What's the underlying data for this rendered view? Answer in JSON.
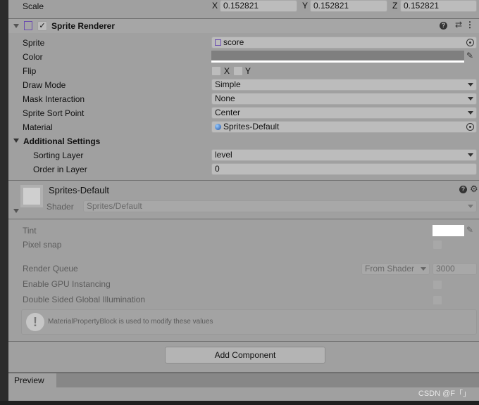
{
  "transform": {
    "scale_label": "Scale",
    "x_label": "X",
    "y_label": "Y",
    "z_label": "Z",
    "x": "0.152821",
    "y": "0.152821",
    "z": "0.152821"
  },
  "sprite_renderer": {
    "title": "Sprite Renderer",
    "enabled": true,
    "sprite_label": "Sprite",
    "sprite_value": "score",
    "color_label": "Color",
    "color_value": "#7f7f7f",
    "flip_label": "Flip",
    "flip_x": "X",
    "flip_y": "Y",
    "draw_mode_label": "Draw Mode",
    "draw_mode": "Simple",
    "mask_label": "Mask Interaction",
    "mask": "None",
    "sort_point_label": "Sprite Sort Point",
    "sort_point": "Center",
    "material_label": "Material",
    "material": "Sprites-Default",
    "additional_label": "Additional Settings",
    "sorting_layer_label": "Sorting Layer",
    "sorting_layer": "level",
    "order_label": "Order in Layer",
    "order": "0"
  },
  "material": {
    "name": "Sprites-Default",
    "shader_label": "Shader",
    "shader": "Sprites/Default",
    "tint_label": "Tint",
    "tint_color": "#ffffff",
    "pixel_snap_label": "Pixel snap",
    "render_queue_label": "Render Queue",
    "render_queue_mode": "From Shader",
    "render_queue": "3000",
    "gpu_label": "Enable GPU Instancing",
    "dsgi_label": "Double Sided Global Illumination",
    "info": "MaterialPropertyBlock is used to modify these values"
  },
  "add_component": "Add Component",
  "preview_tab": "Preview",
  "watermark": "CSDN @F「」"
}
